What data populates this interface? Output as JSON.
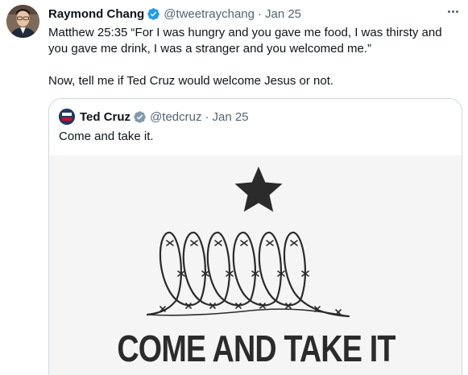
{
  "tweet": {
    "author_name": "Raymond Chang",
    "handle": "@tweetraychang",
    "separator": "·",
    "date": "Jan 25",
    "text": "Matthew 25:35 “For I was hungry and you gave me food, I was thirsty and you gave me drink, I was a stranger and you welcomed me.”\n\nNow, tell me if Ted Cruz would welcome Jesus or not."
  },
  "quoted_tweet": {
    "author_name": "Ted Cruz",
    "handle": "@tedcruz",
    "separator": "·",
    "date": "Jan 25",
    "text": "Come and take it.",
    "media": {
      "flag_text": "COME AND TAKE IT",
      "icons": [
        "star-icon",
        "barbed-wire-icon"
      ]
    }
  },
  "colors": {
    "verified": "#1d9bf0",
    "secondary_text": "#536471",
    "border": "#cfd9de",
    "flag_ink": "#2b2b2b",
    "media_bg": "#f5f5f5"
  },
  "icons": [
    "more-icon",
    "verified-badge-icon",
    "avatar"
  ]
}
